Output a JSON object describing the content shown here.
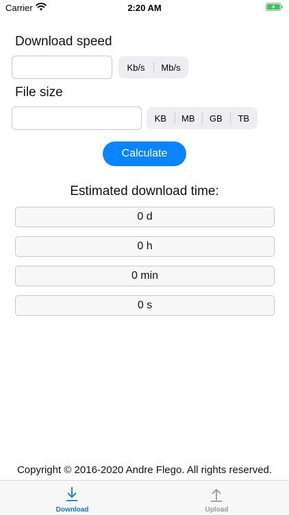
{
  "status_bar": {
    "carrier": "Carrier",
    "time": "2:20 AM",
    "wifi_icon": "wifi-icon",
    "battery_icon": "battery-charging-icon",
    "battery_color": "#34c759"
  },
  "download_speed": {
    "label": "Download speed",
    "value": "",
    "placeholder": "",
    "units": [
      "Kb/s",
      "Mb/s"
    ]
  },
  "file_size": {
    "label": "File size",
    "value": "",
    "placeholder": "",
    "units": [
      "KB",
      "MB",
      "GB",
      "TB"
    ]
  },
  "calculate_button": {
    "label": "Calculate",
    "color": "#0a84ff"
  },
  "results": {
    "title": "Estimated download time:",
    "days": "0 d",
    "hours": "0 h",
    "minutes": "0 min",
    "seconds": "0 s"
  },
  "footer": {
    "copyright": "Copyright © 2016-2020 Andre Flego. All rights reserved."
  },
  "tab_bar": {
    "tabs": [
      {
        "label": "Download",
        "icon": "arrow-down-icon",
        "selected": true,
        "color": "#0a7ad6"
      },
      {
        "label": "Upload",
        "icon": "arrow-up-icon",
        "selected": false,
        "color": "#9a9a9e"
      }
    ]
  }
}
